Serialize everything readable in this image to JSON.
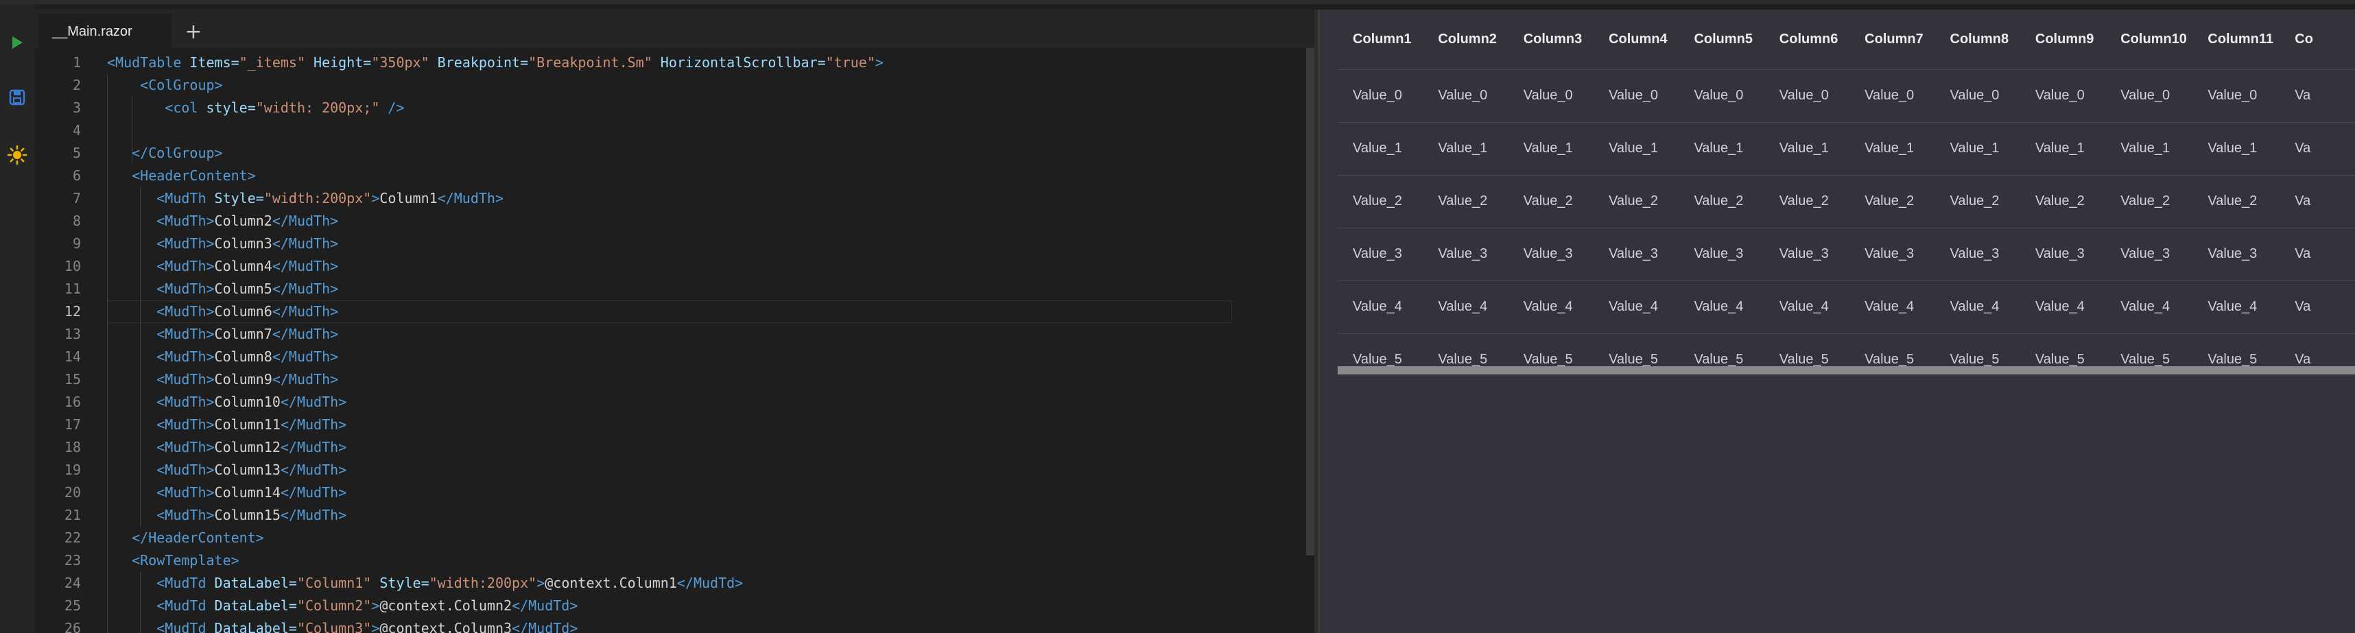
{
  "editor": {
    "tab_label": "__Main.razor",
    "add_tab_glyph": "+",
    "active_line": 12,
    "lines": [
      [
        {
          "c": "t",
          "v": "<MudTable "
        },
        {
          "c": "a",
          "v": "Items="
        },
        {
          "c": "s",
          "v": "\"_items\""
        },
        {
          "c": "a",
          "v": " Height="
        },
        {
          "c": "s",
          "v": "\"350px\""
        },
        {
          "c": "a",
          "v": " Breakpoint="
        },
        {
          "c": "s",
          "v": "\"Breakpoint.Sm\""
        },
        {
          "c": "a",
          "v": " HorizontalScrollbar="
        },
        {
          "c": "s",
          "v": "\"true\""
        },
        {
          "c": "t",
          "v": ">"
        }
      ],
      [
        {
          "c": "txt",
          "v": "    "
        },
        {
          "c": "t",
          "v": "<ColGroup>"
        }
      ],
      [
        {
          "c": "txt",
          "v": "       "
        },
        {
          "c": "t",
          "v": "<col "
        },
        {
          "c": "a",
          "v": "style="
        },
        {
          "c": "s",
          "v": "\"width: 200px;\""
        },
        {
          "c": "t",
          "v": " />"
        }
      ],
      [],
      [
        {
          "c": "txt",
          "v": "   "
        },
        {
          "c": "t",
          "v": "</ColGroup>"
        }
      ],
      [
        {
          "c": "txt",
          "v": "   "
        },
        {
          "c": "t",
          "v": "<HeaderContent>"
        }
      ],
      [
        {
          "c": "txt",
          "v": "      "
        },
        {
          "c": "t",
          "v": "<MudTh "
        },
        {
          "c": "a",
          "v": "Style="
        },
        {
          "c": "s",
          "v": "\"width:200px\""
        },
        {
          "c": "t",
          "v": ">"
        },
        {
          "c": "txt",
          "v": "Column1"
        },
        {
          "c": "t",
          "v": "</MudTh>"
        }
      ],
      [
        {
          "c": "txt",
          "v": "      "
        },
        {
          "c": "t",
          "v": "<MudTh>"
        },
        {
          "c": "txt",
          "v": "Column2"
        },
        {
          "c": "t",
          "v": "</MudTh>"
        }
      ],
      [
        {
          "c": "txt",
          "v": "      "
        },
        {
          "c": "t",
          "v": "<MudTh>"
        },
        {
          "c": "txt",
          "v": "Column3"
        },
        {
          "c": "t",
          "v": "</MudTh>"
        }
      ],
      [
        {
          "c": "txt",
          "v": "      "
        },
        {
          "c": "t",
          "v": "<MudTh>"
        },
        {
          "c": "txt",
          "v": "Column4"
        },
        {
          "c": "t",
          "v": "</MudTh>"
        }
      ],
      [
        {
          "c": "txt",
          "v": "      "
        },
        {
          "c": "t",
          "v": "<MudTh>"
        },
        {
          "c": "txt",
          "v": "Column5"
        },
        {
          "c": "t",
          "v": "</MudTh>"
        }
      ],
      [
        {
          "c": "txt",
          "v": "      "
        },
        {
          "c": "t",
          "v": "<MudTh>"
        },
        {
          "c": "txt",
          "v": "Column6"
        },
        {
          "c": "t",
          "v": "</MudTh>"
        }
      ],
      [
        {
          "c": "txt",
          "v": "      "
        },
        {
          "c": "t",
          "v": "<MudTh>"
        },
        {
          "c": "txt",
          "v": "Column7"
        },
        {
          "c": "t",
          "v": "</MudTh>"
        }
      ],
      [
        {
          "c": "txt",
          "v": "      "
        },
        {
          "c": "t",
          "v": "<MudTh>"
        },
        {
          "c": "txt",
          "v": "Column8"
        },
        {
          "c": "t",
          "v": "</MudTh>"
        }
      ],
      [
        {
          "c": "txt",
          "v": "      "
        },
        {
          "c": "t",
          "v": "<MudTh>"
        },
        {
          "c": "txt",
          "v": "Column9"
        },
        {
          "c": "t",
          "v": "</MudTh>"
        }
      ],
      [
        {
          "c": "txt",
          "v": "      "
        },
        {
          "c": "t",
          "v": "<MudTh>"
        },
        {
          "c": "txt",
          "v": "Column10"
        },
        {
          "c": "t",
          "v": "</MudTh>"
        }
      ],
      [
        {
          "c": "txt",
          "v": "      "
        },
        {
          "c": "t",
          "v": "<MudTh>"
        },
        {
          "c": "txt",
          "v": "Column11"
        },
        {
          "c": "t",
          "v": "</MudTh>"
        }
      ],
      [
        {
          "c": "txt",
          "v": "      "
        },
        {
          "c": "t",
          "v": "<MudTh>"
        },
        {
          "c": "txt",
          "v": "Column12"
        },
        {
          "c": "t",
          "v": "</MudTh>"
        }
      ],
      [
        {
          "c": "txt",
          "v": "      "
        },
        {
          "c": "t",
          "v": "<MudTh>"
        },
        {
          "c": "txt",
          "v": "Column13"
        },
        {
          "c": "t",
          "v": "</MudTh>"
        }
      ],
      [
        {
          "c": "txt",
          "v": "      "
        },
        {
          "c": "t",
          "v": "<MudTh>"
        },
        {
          "c": "txt",
          "v": "Column14"
        },
        {
          "c": "t",
          "v": "</MudTh>"
        }
      ],
      [
        {
          "c": "txt",
          "v": "      "
        },
        {
          "c": "t",
          "v": "<MudTh>"
        },
        {
          "c": "txt",
          "v": "Column15"
        },
        {
          "c": "t",
          "v": "</MudTh>"
        }
      ],
      [
        {
          "c": "txt",
          "v": "   "
        },
        {
          "c": "t",
          "v": "</HeaderContent>"
        }
      ],
      [
        {
          "c": "txt",
          "v": "   "
        },
        {
          "c": "t",
          "v": "<RowTemplate>"
        }
      ],
      [
        {
          "c": "txt",
          "v": "      "
        },
        {
          "c": "t",
          "v": "<MudTd "
        },
        {
          "c": "a",
          "v": "DataLabel="
        },
        {
          "c": "s",
          "v": "\"Column1\""
        },
        {
          "c": "a",
          "v": " Style="
        },
        {
          "c": "s",
          "v": "\"width:200px\""
        },
        {
          "c": "t",
          "v": ">"
        },
        {
          "c": "txt",
          "v": "@context.Column1"
        },
        {
          "c": "t",
          "v": "</MudTd>"
        }
      ],
      [
        {
          "c": "txt",
          "v": "      "
        },
        {
          "c": "t",
          "v": "<MudTd "
        },
        {
          "c": "a",
          "v": "DataLabel="
        },
        {
          "c": "s",
          "v": "\"Column2\""
        },
        {
          "c": "t",
          "v": ">"
        },
        {
          "c": "txt",
          "v": "@context.Column2"
        },
        {
          "c": "t",
          "v": "</MudTd>"
        }
      ],
      [
        {
          "c": "txt",
          "v": "      "
        },
        {
          "c": "t",
          "v": "<MudTd "
        },
        {
          "c": "a",
          "v": "DataLabel="
        },
        {
          "c": "s",
          "v": "\"Column3\""
        },
        {
          "c": "t",
          "v": ">"
        },
        {
          "c": "txt",
          "v": "@context.Column3"
        },
        {
          "c": "t",
          "v": "</MudTd>"
        }
      ]
    ]
  },
  "activity": {
    "icons": [
      "run-icon",
      "save-icon",
      "theme-toggle-icon"
    ],
    "colors": {
      "run": "#2ea043",
      "save": "#3a7bd5",
      "theme": "#f0b400"
    }
  },
  "preview": {
    "headers": [
      "Column1",
      "Column2",
      "Column3",
      "Column4",
      "Column5",
      "Column6",
      "Column7",
      "Column8",
      "Column9",
      "Column10",
      "Column11",
      "Co"
    ],
    "rows": [
      [
        "Value_0",
        "Value_0",
        "Value_0",
        "Value_0",
        "Value_0",
        "Value_0",
        "Value_0",
        "Value_0",
        "Value_0",
        "Value_0",
        "Value_0",
        "Va"
      ],
      [
        "Value_1",
        "Value_1",
        "Value_1",
        "Value_1",
        "Value_1",
        "Value_1",
        "Value_1",
        "Value_1",
        "Value_1",
        "Value_1",
        "Value_1",
        "Va"
      ],
      [
        "Value_2",
        "Value_2",
        "Value_2",
        "Value_2",
        "Value_2",
        "Value_2",
        "Value_2",
        "Value_2",
        "Value_2",
        "Value_2",
        "Value_2",
        "Va"
      ],
      [
        "Value_3",
        "Value_3",
        "Value_3",
        "Value_3",
        "Value_3",
        "Value_3",
        "Value_3",
        "Value_3",
        "Value_3",
        "Value_3",
        "Value_3",
        "Va"
      ],
      [
        "Value_4",
        "Value_4",
        "Value_4",
        "Value_4",
        "Value_4",
        "Value_4",
        "Value_4",
        "Value_4",
        "Value_4",
        "Value_4",
        "Value_4",
        "Va"
      ],
      [
        "Value_5",
        "Value_5",
        "Value_5",
        "Value_5",
        "Value_5",
        "Value_5",
        "Value_5",
        "Value_5",
        "Value_5",
        "Value_5",
        "Value_5",
        "Va"
      ]
    ]
  }
}
